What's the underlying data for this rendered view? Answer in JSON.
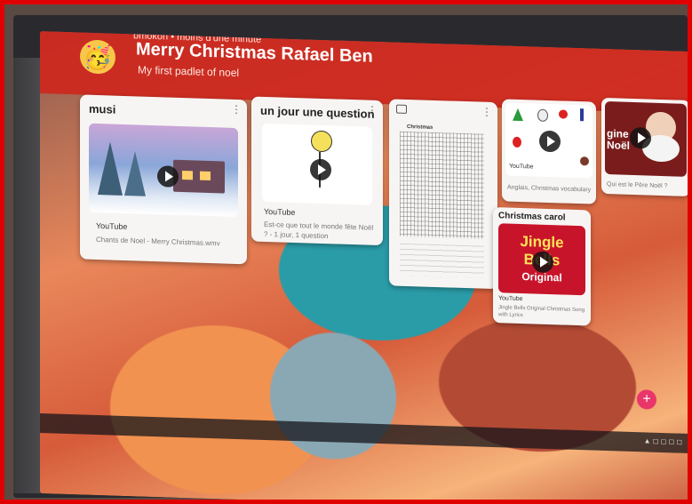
{
  "header": {
    "meta": "bmokon • moins d'une minute",
    "title": "Merry Christmas Rafael Ben",
    "subtitle": "My first padlet of noel"
  },
  "cards": {
    "musi": {
      "title": "musi",
      "source": "YouTube",
      "desc": "Chants de Noel - Merry Christmas.wmv"
    },
    "question": {
      "title": "un jour une question",
      "source": "YouTube",
      "desc": "Est-ce que tout le monde fête Noël ? - 1 jour, 1 question"
    },
    "wordsearch": {
      "title": "Christmas"
    },
    "vocab": {
      "source": "YouTube",
      "desc": "Anglais, Christmas vocabulary"
    },
    "santa": {
      "thumb_text": "gine Noël",
      "desc": "Qui est le Père Noël ?"
    },
    "carol": {
      "title": "Christmas carol",
      "jingle_line1": "Jingle",
      "jingle_line2": "Bells",
      "jingle_line3": "Original",
      "source": "YouTube",
      "desc": "Jingle Bells Original Christmas Song with Lyrics"
    }
  },
  "fab": {
    "label": "+"
  },
  "colors": {
    "header": "#cd281e",
    "frame": "#e00000",
    "fab": "#e8366a"
  }
}
